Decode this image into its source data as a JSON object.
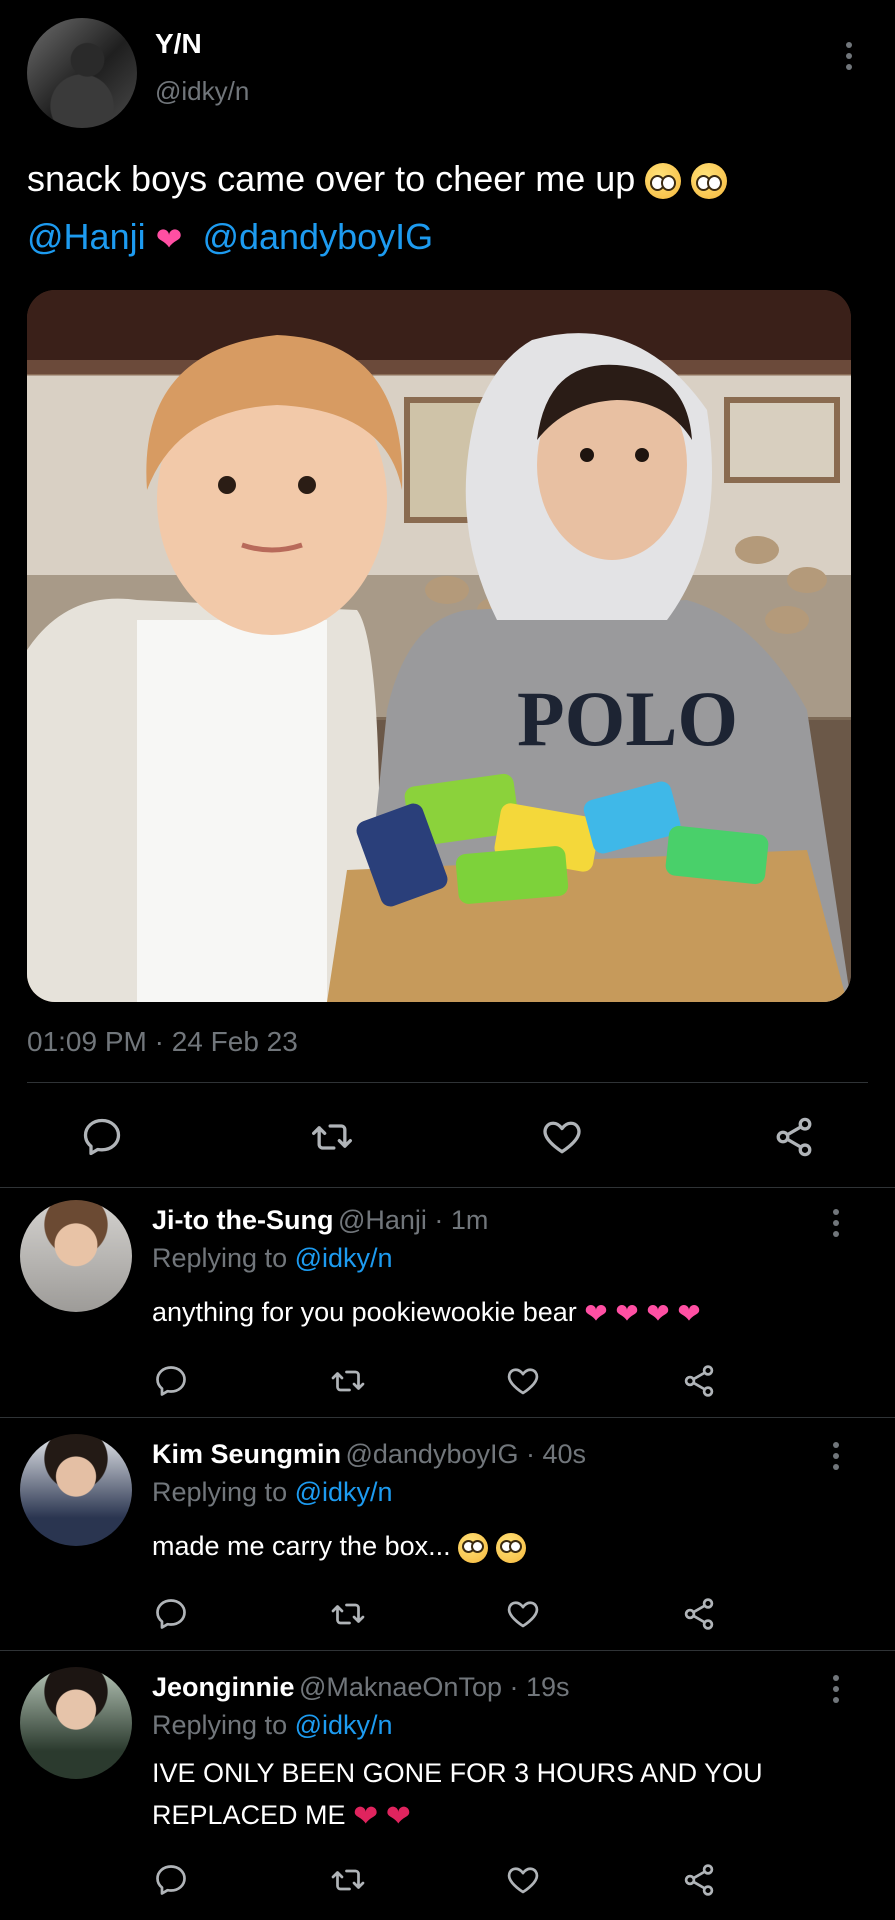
{
  "tweet": {
    "author_name": "Y/N",
    "author_handle": "@idky/n",
    "text": "snack boys came over to cheer me up",
    "mention_1": "@Hanji",
    "mention_2": "@dandyboyIG",
    "timestamp": "01:09 PM · 24 Feb 23",
    "icons": {
      "reply": "comment-icon",
      "retweet": "retweet-icon",
      "like": "heart-icon",
      "share": "share-icon",
      "more": "more-dots-icon"
    }
  },
  "replies": [
    {
      "name": "Ji-to the-Sung",
      "handle": "@Hanji · 1m",
      "replying_label": "Replying to",
      "replying_to": "@idky/n",
      "text": "anything for you pookiewookie bear"
    },
    {
      "name": "Kim Seungmin",
      "handle": "@dandyboyIG · 40s",
      "replying_label": "Replying to",
      "replying_to": "@idky/n",
      "text": "made me carry the box..."
    },
    {
      "name": "Jeonginnie",
      "handle": "@MaknaeOnTop · 19s",
      "replying_label": "Replying to",
      "replying_to": "@idky/n",
      "text_line_1": "IVE ONLY BEEN GONE FOR 3 HOURS AND YOU",
      "text_line_2": "REPLACED ME"
    }
  ],
  "colors": {
    "background": "#000000",
    "text": "#ffffff",
    "secondary": "#71767b",
    "accent": "#1d9bf0",
    "divider": "#2f3336"
  }
}
